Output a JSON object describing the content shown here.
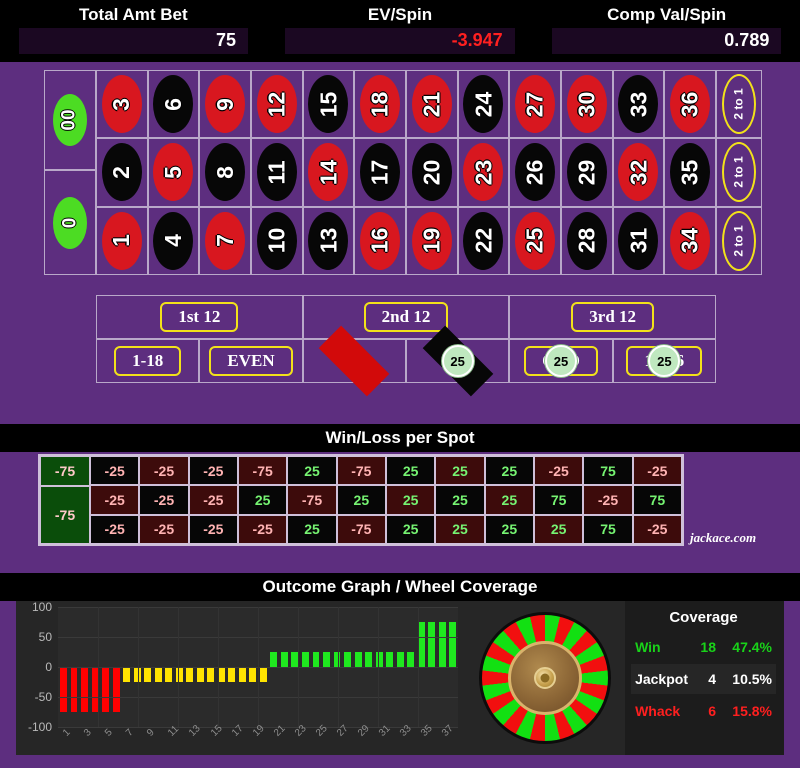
{
  "header": {
    "stats": [
      {
        "label": "Total Amt Bet",
        "value": "75",
        "negative": false
      },
      {
        "label": "EV/Spin",
        "value": "-3.947",
        "negative": true
      },
      {
        "label": "Comp Val/Spin",
        "value": "0.789",
        "negative": false
      }
    ]
  },
  "table": {
    "zeros": [
      {
        "label": "00",
        "chip": null
      },
      {
        "label": "0",
        "chip": null
      }
    ],
    "numbers": [
      {
        "n": "3",
        "color": "red"
      },
      {
        "n": "6",
        "color": "black"
      },
      {
        "n": "9",
        "color": "red"
      },
      {
        "n": "12",
        "color": "red"
      },
      {
        "n": "15",
        "color": "black"
      },
      {
        "n": "18",
        "color": "red"
      },
      {
        "n": "21",
        "color": "red"
      },
      {
        "n": "24",
        "color": "black"
      },
      {
        "n": "27",
        "color": "red"
      },
      {
        "n": "30",
        "color": "red"
      },
      {
        "n": "33",
        "color": "black"
      },
      {
        "n": "36",
        "color": "red"
      },
      {
        "n": "2",
        "color": "black"
      },
      {
        "n": "5",
        "color": "red"
      },
      {
        "n": "8",
        "color": "black"
      },
      {
        "n": "11",
        "color": "black"
      },
      {
        "n": "14",
        "color": "red"
      },
      {
        "n": "17",
        "color": "black"
      },
      {
        "n": "20",
        "color": "black"
      },
      {
        "n": "23",
        "color": "red"
      },
      {
        "n": "26",
        "color": "black"
      },
      {
        "n": "29",
        "color": "black"
      },
      {
        "n": "32",
        "color": "red"
      },
      {
        "n": "35",
        "color": "black"
      },
      {
        "n": "1",
        "color": "red"
      },
      {
        "n": "4",
        "color": "black"
      },
      {
        "n": "7",
        "color": "red"
      },
      {
        "n": "10",
        "color": "black"
      },
      {
        "n": "13",
        "color": "black"
      },
      {
        "n": "16",
        "color": "red"
      },
      {
        "n": "19",
        "color": "red"
      },
      {
        "n": "22",
        "color": "black"
      },
      {
        "n": "25",
        "color": "red"
      },
      {
        "n": "28",
        "color": "black"
      },
      {
        "n": "31",
        "color": "black"
      },
      {
        "n": "34",
        "color": "red"
      }
    ],
    "column_bets": [
      "2 to 1",
      "2 to 1",
      "2 to 1"
    ],
    "dozens": [
      "1st 12",
      "2nd 12",
      "3rd 12"
    ],
    "outside": [
      {
        "label": "1-18",
        "kind": "pill",
        "chip": null
      },
      {
        "label": "EVEN",
        "kind": "pill",
        "chip": null
      },
      {
        "label": "",
        "kind": "diamond-red",
        "chip": null
      },
      {
        "label": "",
        "kind": "diamond-black",
        "chip": "25"
      },
      {
        "label": "ODD",
        "kind": "pill",
        "chip": "25"
      },
      {
        "label": "19-36",
        "kind": "pill",
        "chip": "25"
      }
    ]
  },
  "winloss": {
    "title": "Win/Loss per Spot",
    "zero_cells": [
      "-75",
      "-75"
    ],
    "rows": [
      [
        "-25",
        "-25",
        "-25",
        "-75",
        "25",
        "-75",
        "25",
        "25",
        "25",
        "-25",
        "75",
        "-25"
      ],
      [
        "-25",
        "-25",
        "-25",
        "25",
        "-75",
        "25",
        "25",
        "25",
        "25",
        "75",
        "-25",
        "75"
      ],
      [
        "-25",
        "-25",
        "-25",
        "-25",
        "25",
        "-75",
        "25",
        "25",
        "25",
        "25",
        "75",
        "-25"
      ]
    ],
    "watermark": "jackace.com"
  },
  "outcome": {
    "title": "Outcome Graph / Wheel Coverage"
  },
  "chart_data": {
    "type": "bar",
    "title": "Outcome Graph / Wheel Coverage",
    "xlabel": "",
    "ylabel": "",
    "ylim": [
      -100,
      100
    ],
    "yticks": [
      100,
      50,
      0,
      -50,
      -100
    ],
    "xticks": [
      "1",
      "3",
      "5",
      "7",
      "9",
      "11",
      "13",
      "15",
      "17",
      "19",
      "21",
      "23",
      "25",
      "27",
      "29",
      "31",
      "33",
      "35",
      "37"
    ],
    "x": [
      1,
      2,
      3,
      4,
      5,
      6,
      7,
      8,
      9,
      10,
      11,
      12,
      13,
      14,
      15,
      16,
      17,
      18,
      19,
      20,
      21,
      22,
      23,
      24,
      25,
      26,
      27,
      28,
      29,
      30,
      31,
      32,
      33,
      34,
      35,
      36,
      37,
      38
    ],
    "values": [
      -75,
      -75,
      -75,
      -75,
      -75,
      -75,
      -25,
      -25,
      -25,
      -25,
      -25,
      -25,
      -25,
      -25,
      -25,
      -25,
      -25,
      -25,
      -25,
      -25,
      25,
      25,
      25,
      25,
      25,
      25,
      25,
      25,
      25,
      25,
      25,
      25,
      25,
      25,
      75,
      75,
      75,
      75
    ],
    "bar_colors": [
      "#ff0000",
      "#ff0000",
      "#ff0000",
      "#ff0000",
      "#ff0000",
      "#ff0000",
      "#ffe400",
      "#ffe400",
      "#ffe400",
      "#ffe400",
      "#ffe400",
      "#ffe400",
      "#ffe400",
      "#ffe400",
      "#ffe400",
      "#ffe400",
      "#ffe400",
      "#ffe400",
      "#ffe400",
      "#ffe400",
      "#1fe81f",
      "#1fe81f",
      "#1fe81f",
      "#1fe81f",
      "#1fe81f",
      "#1fe81f",
      "#1fe81f",
      "#1fe81f",
      "#1fe81f",
      "#1fe81f",
      "#1fe81f",
      "#1fe81f",
      "#1fe81f",
      "#1fe81f",
      "#1fe81f",
      "#1fe81f",
      "#1fe81f",
      "#1fe81f"
    ],
    "grid": true,
    "legend": null
  },
  "coverage": {
    "title": "Coverage",
    "rows": [
      {
        "label": "Win",
        "count": "18",
        "pct": "47.4%",
        "tone": "win"
      },
      {
        "label": "Jackpot",
        "count": "4",
        "pct": "10.5%",
        "tone": "jack"
      },
      {
        "label": "Whack",
        "count": "6",
        "pct": "15.8%",
        "tone": "whack"
      }
    ]
  },
  "colors": {
    "felt": "#5d2e7f",
    "red": "#d8171f",
    "black": "#070707",
    "green": "#4cdc23",
    "yellow": "#f2e21a",
    "win_green": "#19d219",
    "whack_red": "#ff1f1f"
  }
}
